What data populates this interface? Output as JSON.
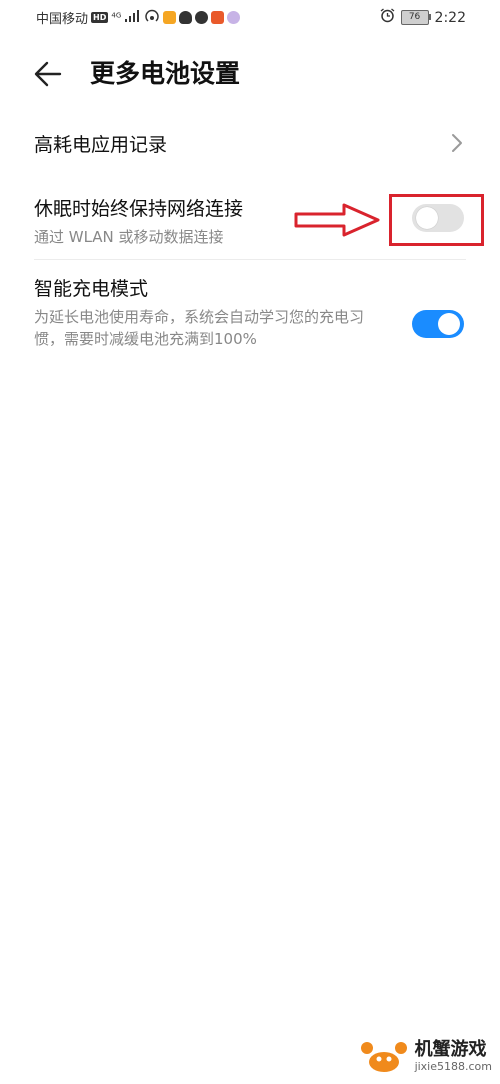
{
  "status_bar": {
    "carrier": "中国移动",
    "hd": "HD",
    "network": "4G",
    "battery": "76",
    "time": "2:22"
  },
  "header": {
    "title": "更多电池设置"
  },
  "settings": [
    {
      "title": "高耗电应用记录",
      "subtitle": "",
      "control": "chevron"
    },
    {
      "title": "休眠时始终保持网络连接",
      "subtitle": "通过 WLAN 或移动数据连接",
      "control": "toggle",
      "checked": false
    },
    {
      "title": "智能充电模式",
      "subtitle": "为延长电池使用寿命，系统会自动学习您的充电习惯，需要时减缓电池充满到100%",
      "control": "toggle",
      "checked": true
    }
  ],
  "annotation": {
    "color": "#d9232d"
  },
  "colors": {
    "toggle_on": "#1a8cff",
    "toggle_off": "#e2e2e2"
  },
  "watermark": {
    "name": "机蟹游戏",
    "url": "jixie5188.com"
  }
}
